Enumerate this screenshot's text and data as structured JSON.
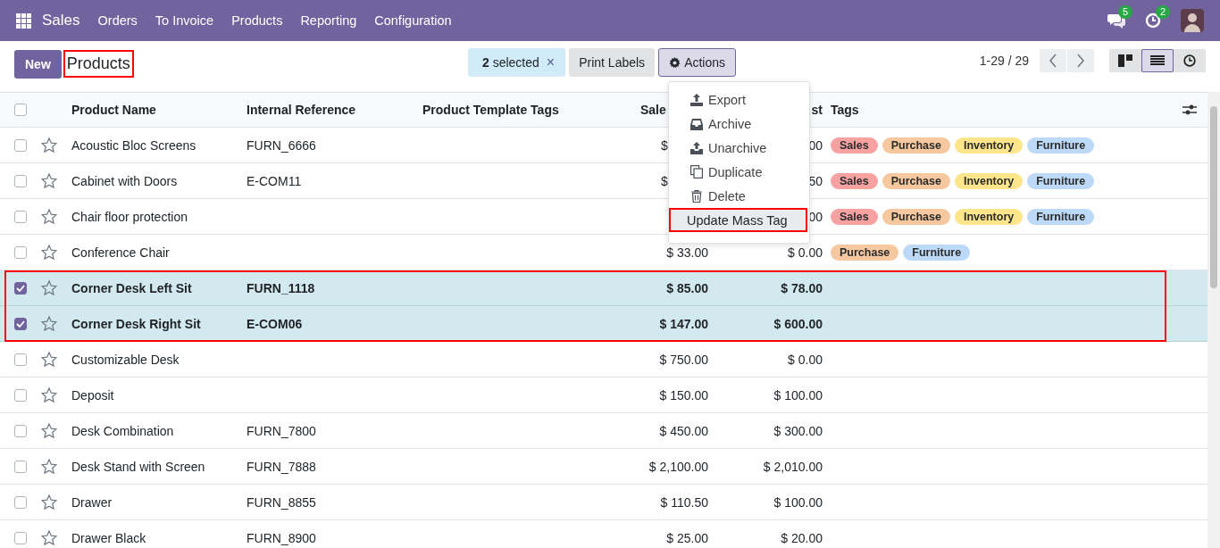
{
  "navbar": {
    "app": "Sales",
    "menu": [
      "Orders",
      "To Invoice",
      "Products",
      "Reporting",
      "Configuration"
    ],
    "messages_badge": "5",
    "activities_badge": "2"
  },
  "control_panel": {
    "new_button": "New",
    "title": "Products",
    "title_annotated": true,
    "selection": {
      "count": "2",
      "label": "selected",
      "clear": "×"
    },
    "print_button": "Print Labels",
    "actions_button": "Actions",
    "pager": "1-29 / 29",
    "views": [
      {
        "kind": "kanban",
        "selected": false
      },
      {
        "kind": "list",
        "selected": true
      },
      {
        "kind": "activity",
        "selected": false
      }
    ]
  },
  "actions_menu": {
    "open": true,
    "items": [
      {
        "kind": "export",
        "label": "Export",
        "active": false,
        "annotated": false
      },
      {
        "kind": "archive",
        "label": "Archive",
        "active": false,
        "annotated": false
      },
      {
        "kind": "unarchive",
        "label": "Unarchive",
        "active": false,
        "annotated": false
      },
      {
        "kind": "duplicate",
        "label": "Duplicate",
        "active": false,
        "annotated": false
      },
      {
        "kind": "delete",
        "label": "Delete",
        "active": false,
        "annotated": false
      },
      {
        "kind": "plain",
        "label": "Update Mass Tag",
        "active": true,
        "annotated": true
      }
    ]
  },
  "table": {
    "columns": {
      "name": "Product Name",
      "reference": "Internal Reference",
      "template_tags": "Product Template Tags",
      "sale_price": "Sale",
      "cost": "st",
      "tags": "Tags"
    },
    "selected_rows_annotated": true,
    "all_selected": false,
    "rows": [
      {
        "name": "Acoustic Bloc Screens",
        "reference": "FURN_6666",
        "sale_price": "$",
        "covered": true,
        "cost": "00",
        "selected": false,
        "tags": [
          {
            "label": "Sales",
            "color": "#f7a1a1"
          },
          {
            "label": "Purchase",
            "color": "#f6c89f"
          },
          {
            "label": "Inventory",
            "color": "#fde58c"
          },
          {
            "label": "Furniture",
            "color": "#bcd9f7"
          }
        ]
      },
      {
        "name": "Cabinet with Doors",
        "reference": "E-COM11",
        "sale_price": "$",
        "covered": true,
        "cost": "50",
        "selected": false,
        "tags": [
          {
            "label": "Sales",
            "color": "#f7a1a1"
          },
          {
            "label": "Purchase",
            "color": "#f6c89f"
          },
          {
            "label": "Inventory",
            "color": "#fde58c"
          },
          {
            "label": "Furniture",
            "color": "#bcd9f7"
          }
        ]
      },
      {
        "name": "Chair floor protection",
        "reference": "",
        "cost": "00",
        "selected": false,
        "tags": [
          {
            "label": "Sales",
            "color": "#f7a1a1"
          },
          {
            "label": "Purchase",
            "color": "#f6c89f"
          },
          {
            "label": "Inventory",
            "color": "#fde58c"
          },
          {
            "label": "Furniture",
            "color": "#bcd9f7"
          }
        ]
      },
      {
        "name": "Conference Chair",
        "reference": "",
        "sale_price": "$ 33.00",
        "cost": "$ 0.00",
        "selected": false,
        "tags": [
          {
            "label": "Purchase",
            "color": "#f6c89f"
          },
          {
            "label": "Furniture",
            "color": "#bcd9f7"
          }
        ]
      },
      {
        "name": "Corner Desk Left Sit",
        "reference": "FURN_1118",
        "sale_price": "$ 85.00",
        "cost": "$ 78.00",
        "selected": true,
        "tags": []
      },
      {
        "name": "Corner Desk Right Sit",
        "reference": "E-COM06",
        "sale_price": "$ 147.00",
        "cost": "$ 600.00",
        "selected": true,
        "tags": []
      },
      {
        "name": "Customizable Desk",
        "reference": "",
        "sale_price": "$ 750.00",
        "cost": "$ 0.00",
        "selected": false,
        "tags": []
      },
      {
        "name": "Deposit",
        "reference": "",
        "sale_price": "$ 150.00",
        "cost": "$ 100.00",
        "selected": false,
        "tags": []
      },
      {
        "name": "Desk Combination",
        "reference": "FURN_7800",
        "sale_price": "$ 450.00",
        "cost": "$ 300.00",
        "selected": false,
        "tags": []
      },
      {
        "name": "Desk Stand with Screen",
        "reference": "FURN_7888",
        "sale_price": "$ 2,100.00",
        "cost": "$ 2,010.00",
        "selected": false,
        "tags": []
      },
      {
        "name": "Drawer",
        "reference": "FURN_8855",
        "sale_price": "$ 110.50",
        "cost": "$ 100.00",
        "selected": false,
        "tags": []
      },
      {
        "name": "Drawer Black",
        "reference": "FURN_8900",
        "sale_price": "$ 25.00",
        "cost": "$ 20.00",
        "selected": false,
        "tags": []
      }
    ]
  }
}
